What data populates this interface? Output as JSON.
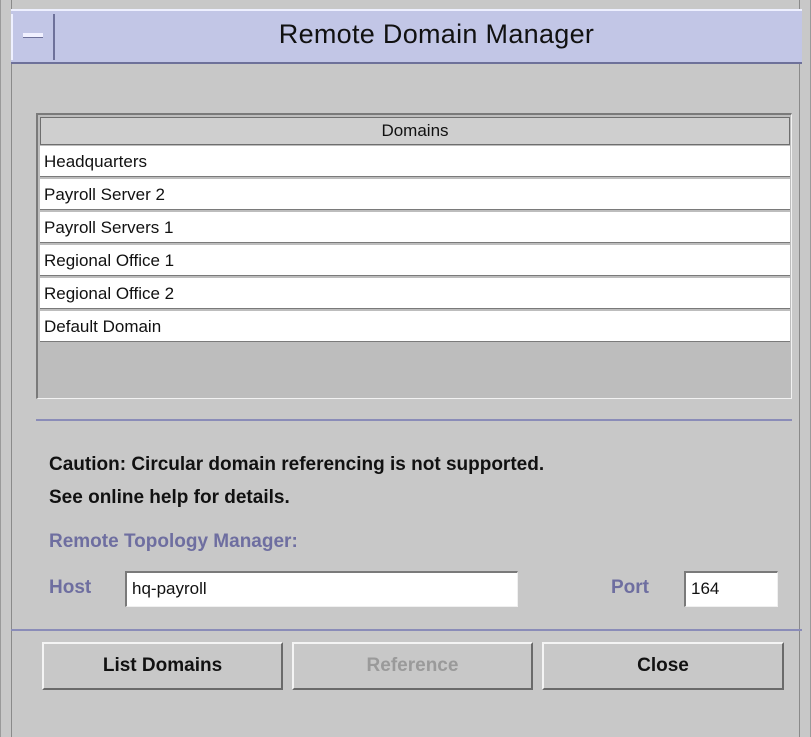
{
  "window": {
    "title": "Remote Domain Manager"
  },
  "table": {
    "header": "Domains",
    "rows": [
      "Headquarters",
      "Payroll Server 2",
      "Payroll Servers 1",
      "Regional Office 1",
      "Regional Office 2",
      "Default Domain"
    ]
  },
  "caution": {
    "line1": "Caution: Circular domain referencing is not supported.",
    "line2": "See online help for details."
  },
  "rtm": {
    "label": "Remote Topology Manager:",
    "host_label": "Host",
    "host_value": "hq-payroll",
    "port_label": "Port",
    "port_value": "164"
  },
  "buttons": {
    "list": "List Domains",
    "reference": "Reference",
    "close": "Close"
  },
  "colors": {
    "titlebar": "#c2c6e6",
    "label_accent": "#6e6ea0"
  }
}
